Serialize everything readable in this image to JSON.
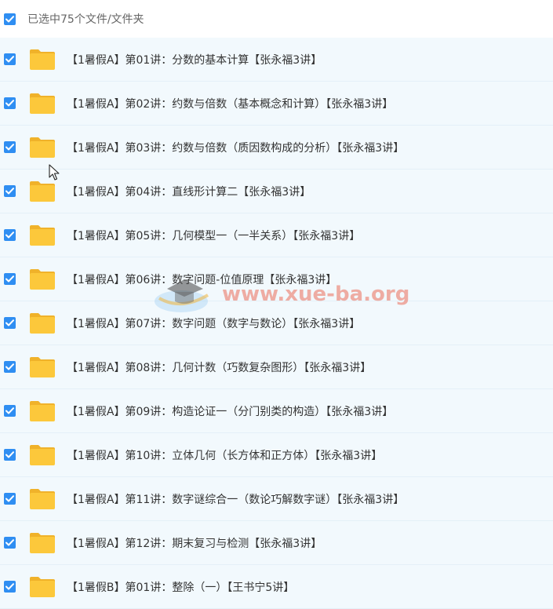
{
  "header": {
    "selection_label": "已选中75个文件/文件夹"
  },
  "files": [
    {
      "name": "【1暑假A】第01讲：分数的基本计算【张永福3讲】",
      "checked": true
    },
    {
      "name": "【1暑假A】第02讲：约数与倍数（基本概念和计算）【张永福3讲】",
      "checked": true
    },
    {
      "name": "【1暑假A】第03讲：约数与倍数（质因数构成的分析）【张永福3讲】",
      "checked": true
    },
    {
      "name": "【1暑假A】第04讲：直线形计算二【张永福3讲】",
      "checked": true
    },
    {
      "name": "【1暑假A】第05讲：几何模型一（一半关系）【张永福3讲】",
      "checked": true
    },
    {
      "name": "【1暑假A】第06讲：数字问题-位值原理【张永福3讲】",
      "checked": true
    },
    {
      "name": "【1暑假A】第07讲：数字问题（数字与数论）【张永福3讲】",
      "checked": true
    },
    {
      "name": "【1暑假A】第08讲：几何计数（巧数复杂图形）【张永福3讲】",
      "checked": true
    },
    {
      "name": "【1暑假A】第09讲：构造论证一（分门别类的构造）【张永福3讲】",
      "checked": true
    },
    {
      "name": "【1暑假A】第10讲：立体几何（长方体和正方体）【张永福3讲】",
      "checked": true
    },
    {
      "name": "【1暑假A】第11讲：数字谜综合一（数论巧解数字谜）【张永福3讲】",
      "checked": true
    },
    {
      "name": "【1暑假A】第12讲：期末复习与检测【张永福3讲】",
      "checked": true
    },
    {
      "name": "【1暑假B】第01讲：整除（一）【王书宁5讲】",
      "checked": true
    }
  ],
  "watermark": {
    "text": "www.xue-ba.org"
  },
  "colors": {
    "checkbox": "#2f8ef2",
    "folder": "#fcc83b",
    "row_bg": "#f2f9fd"
  }
}
